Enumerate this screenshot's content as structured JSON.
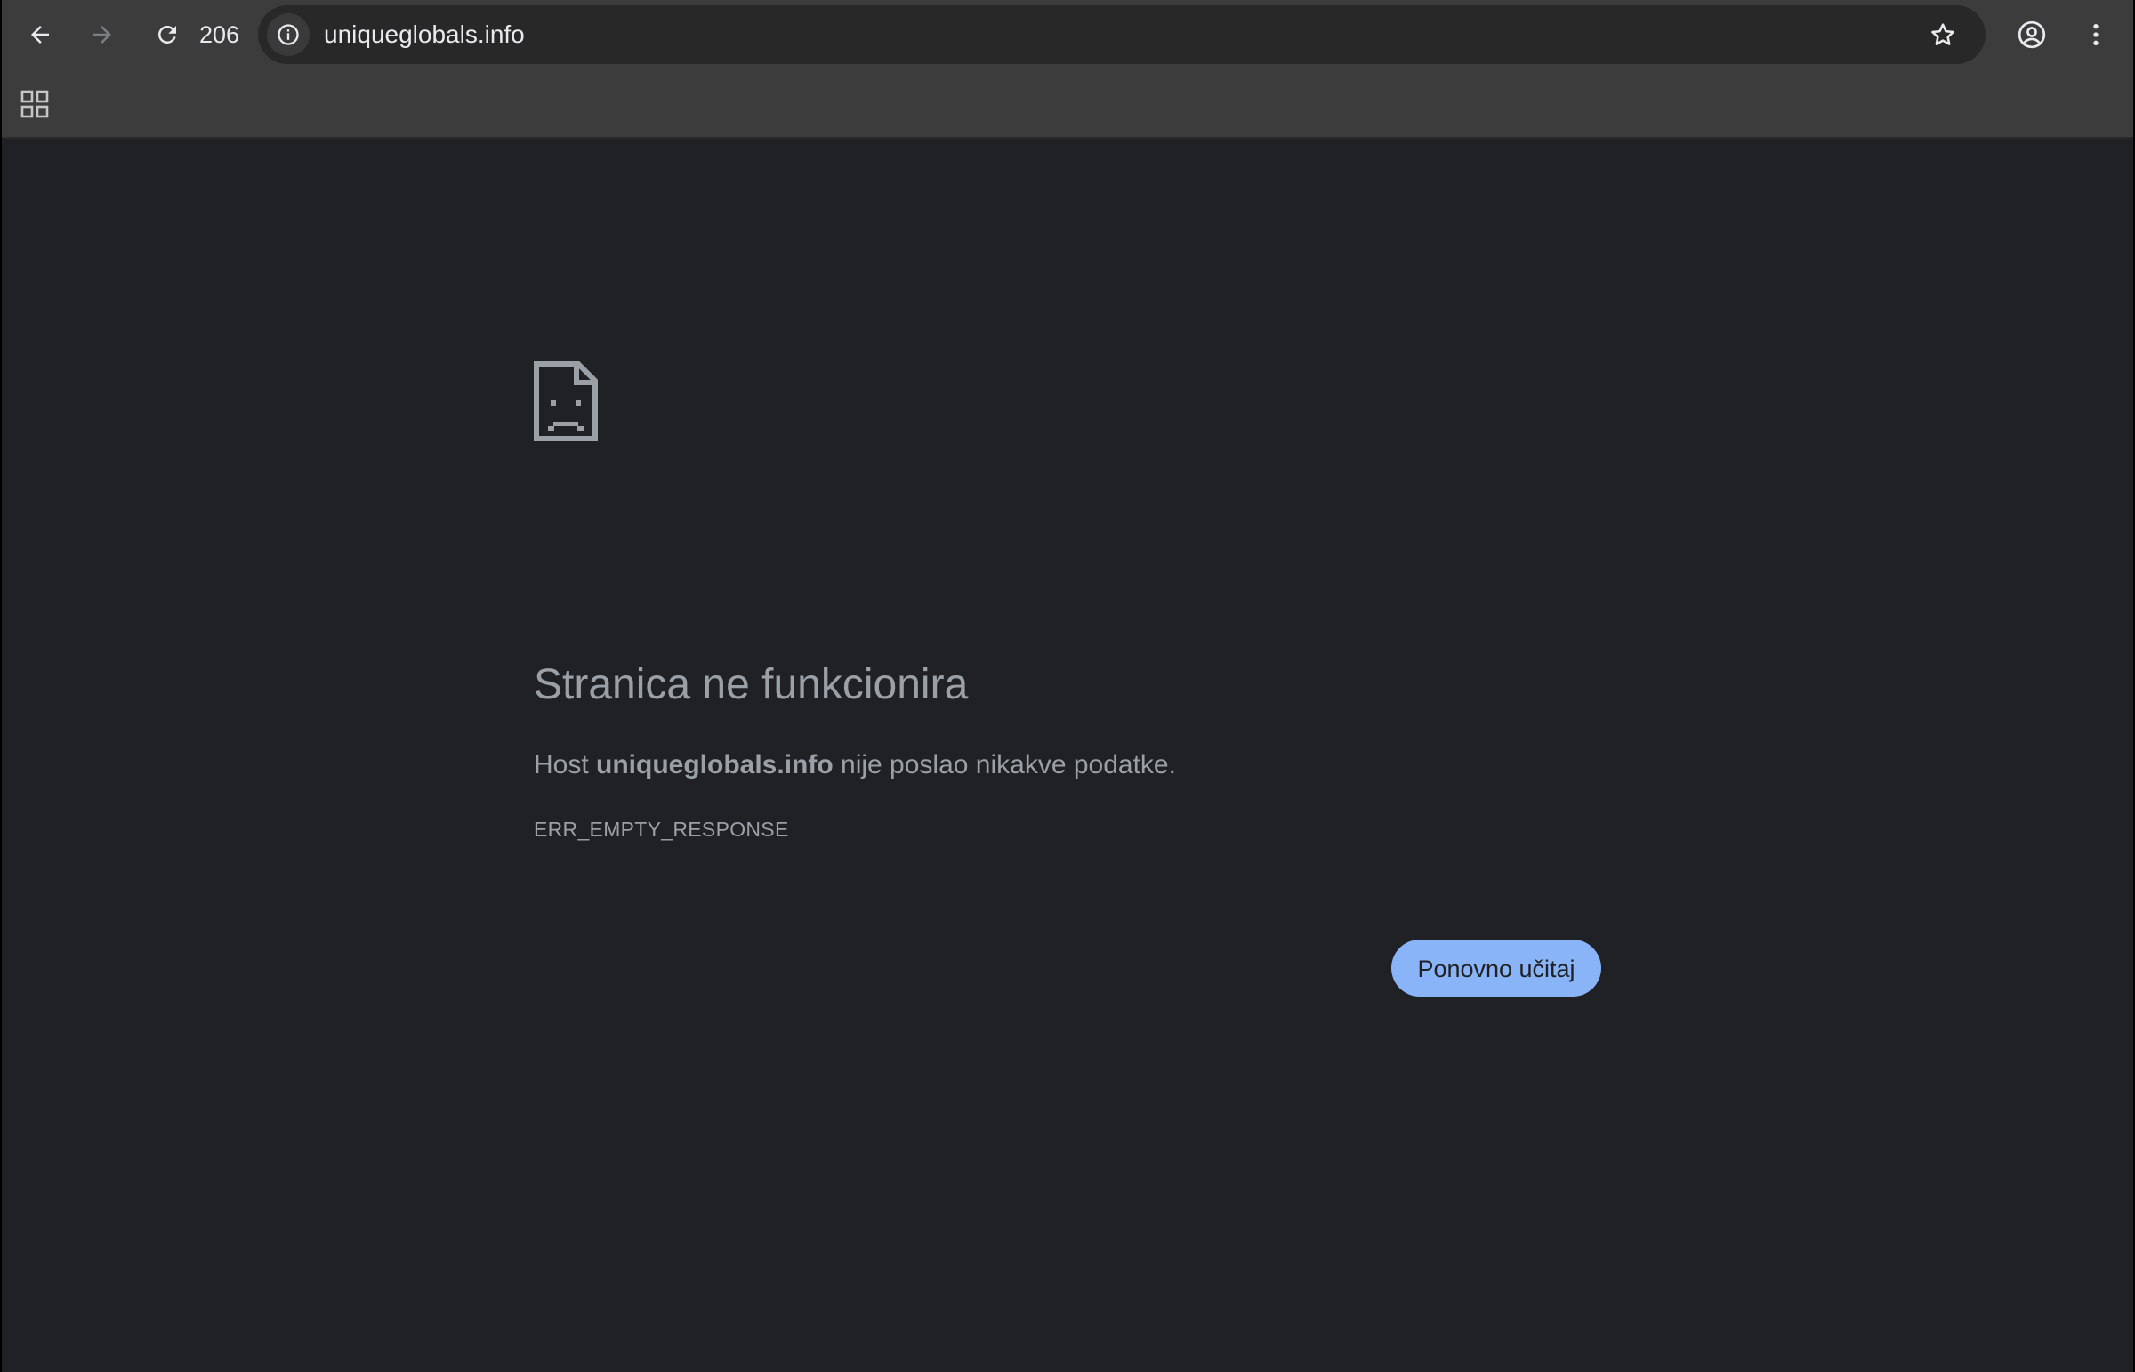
{
  "browser": {
    "reload_count": "206",
    "url": "uniqueglobals.info"
  },
  "icons": {
    "back": "arrow-left-icon",
    "forward": "arrow-right-icon",
    "reload": "reload-icon",
    "site_info": "info-icon",
    "bookmark": "star-icon",
    "profile": "account-circle-icon",
    "menu": "more-vert-icon",
    "apps": "apps-grid-icon",
    "error": "sad-document-icon"
  },
  "error_page": {
    "title": "Stranica ne funkcionira",
    "description_prefix": "Host ",
    "host": "uniqueglobals.info",
    "description_suffix": " nije poslao nikakve podatke.",
    "error_code": "ERR_EMPTY_RESPONSE",
    "reload_button": "Ponovno učitaj"
  },
  "colors": {
    "background": "#202124",
    "toolbar": "#3c3c3c",
    "text_secondary": "#9aa0a6",
    "accent": "#8ab4f8"
  }
}
